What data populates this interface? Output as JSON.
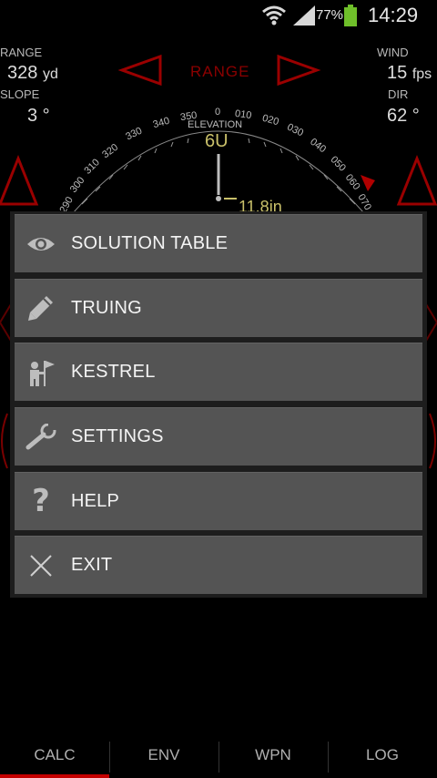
{
  "status_bar": {
    "battery_percent": "77%",
    "time": "14:29"
  },
  "calculator": {
    "range_label": "RANGE",
    "range_value": "328",
    "range_unit": "yd",
    "slope_label": "SLOPE",
    "slope_value": "3 °",
    "wind_label": "WIND",
    "wind_value": "15",
    "wind_unit": "fps",
    "dir_label": "DIR",
    "dir_value": "62 °",
    "range_title": "RANGE",
    "elevation_label": "ELEVATION",
    "elevation_value": "6U",
    "drop_value": "11.8in",
    "dial_ticks": [
      "290",
      "300",
      "310",
      "320",
      "330",
      "340",
      "350",
      "0",
      "010",
      "020",
      "030",
      "040",
      "050",
      "060",
      "070"
    ]
  },
  "menu": {
    "items": [
      {
        "label": "SOLUTION TABLE",
        "icon": "eye-icon"
      },
      {
        "label": "TRUING",
        "icon": "pencil-icon"
      },
      {
        "label": "KESTREL",
        "icon": "person-flag-icon"
      },
      {
        "label": "SETTINGS",
        "icon": "wrench-icon"
      },
      {
        "label": "HELP",
        "icon": "question-icon"
      },
      {
        "label": "EXIT",
        "icon": "close-icon"
      }
    ]
  },
  "tabs": [
    {
      "label": "CALC",
      "active": true
    },
    {
      "label": "ENV",
      "active": false
    },
    {
      "label": "WPN",
      "active": false
    },
    {
      "label": "LOG",
      "active": false
    }
  ],
  "colors": {
    "accent": "#c40000",
    "menu_item_bg": "#545454",
    "menu_bg": "#1d1d1d",
    "elevation_text": "#c9c06a"
  }
}
